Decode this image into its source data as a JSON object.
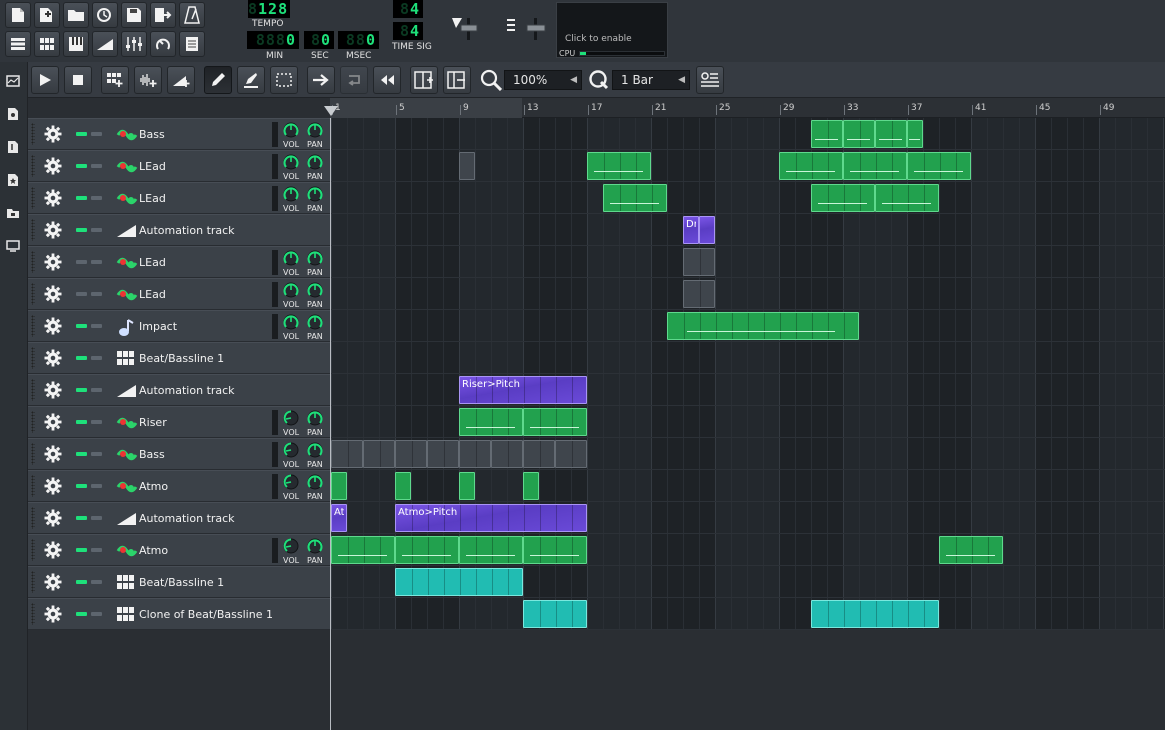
{
  "transport": {
    "tempo": "128",
    "tempo_label": "TEMPO",
    "time_min": "0",
    "time_sec": "0",
    "time_msec": "0",
    "min_label": "MIN",
    "sec_label": "SEC",
    "msec_label": "MSEC",
    "timesig_num": "4",
    "timesig_den": "4",
    "timesig_label": "TIME SIG"
  },
  "cpu": {
    "hint": "Click to enable",
    "label": "CPU"
  },
  "editor": {
    "zoom": "100%",
    "quantize": "1 Bar"
  },
  "timeline": {
    "bar_numbers": [
      "1",
      "5",
      "9",
      "13",
      "17",
      "21",
      "25",
      "29",
      "33",
      "37",
      "41",
      "45",
      "49"
    ]
  },
  "tracks": [
    {
      "name": "Bass",
      "type": "instrument",
      "knobs": true
    },
    {
      "name": "LEad",
      "type": "instrument",
      "knobs": true
    },
    {
      "name": "LEad",
      "type": "instrument",
      "knobs": true
    },
    {
      "name": "Automation track",
      "type": "automation",
      "knobs": false
    },
    {
      "name": "LEad",
      "type": "instrument",
      "knobs": true
    },
    {
      "name": "LEad",
      "type": "instrument",
      "knobs": true
    },
    {
      "name": "Impact",
      "type": "sample",
      "knobs": true
    },
    {
      "name": "Beat/Bassline 1",
      "type": "beat",
      "knobs": false
    },
    {
      "name": "Automation track",
      "type": "automation",
      "knobs": false
    },
    {
      "name": "Riser",
      "type": "instrument",
      "knobs": true
    },
    {
      "name": "Bass",
      "type": "instrument",
      "knobs": true
    },
    {
      "name": "Atmo",
      "type": "instrument",
      "knobs": true
    },
    {
      "name": "Automation track",
      "type": "automation",
      "knobs": false
    },
    {
      "name": "Atmo",
      "type": "instrument",
      "knobs": true
    },
    {
      "name": "Beat/Bassline 1",
      "type": "beat",
      "knobs": false
    },
    {
      "name": "Clone of Beat/Bassline 1",
      "type": "beat",
      "knobs": false
    }
  ],
  "knob_labels": {
    "vol": "VOL",
    "pan": "PAN"
  },
  "clip_labels": {
    "automation_1": "DraDra",
    "automation_2": "Riser>Pitch",
    "automation_3a": "At",
    "automation_3b": "Atmo>Pitch"
  },
  "colors": {
    "pattern_green": "#22a14e",
    "beat_teal": "#21bcb2",
    "automation_purple": "#6a4ad8",
    "lcd_green": "#1ee07a"
  }
}
